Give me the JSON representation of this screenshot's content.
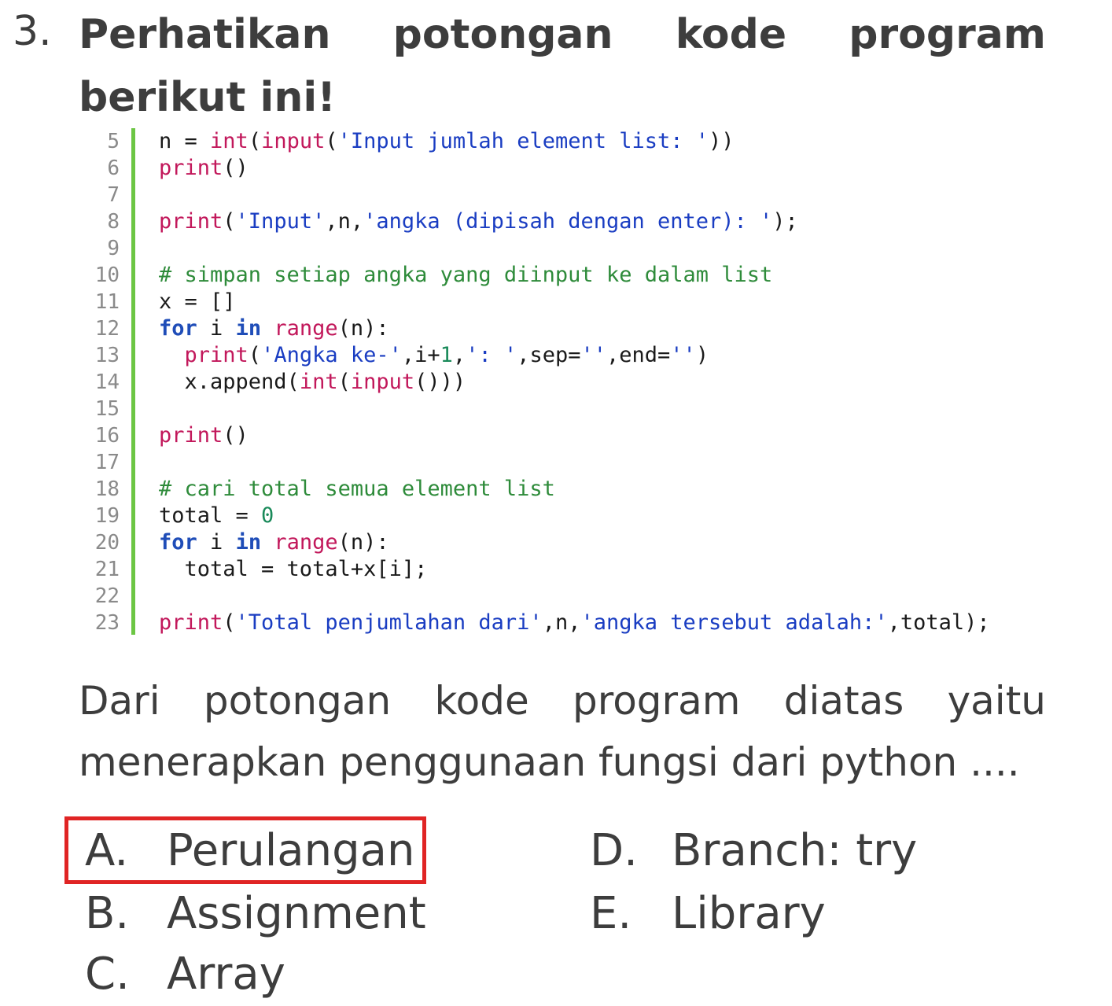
{
  "question": {
    "number": "3.",
    "title": "Perhatikan potongan kode program berikut ini!",
    "text": "Dari potongan kode program diatas yaitu menerapkan penggunaan fungsi dari python ...."
  },
  "code": {
    "lines": [
      {
        "num": "5",
        "text": "n = int(input('Input jumlah element list: '))"
      },
      {
        "num": "6",
        "text": "print()"
      },
      {
        "num": "7",
        "text": ""
      },
      {
        "num": "8",
        "text": "print('Input',n,'angka (dipisah dengan enter): ');"
      },
      {
        "num": "9",
        "text": ""
      },
      {
        "num": "10",
        "text": "# simpan setiap angka yang diinput ke dalam list"
      },
      {
        "num": "11",
        "text": "x = []"
      },
      {
        "num": "12",
        "text": "for i in range(n):"
      },
      {
        "num": "13",
        "text": "  print('Angka ke-',i+1,': ',sep='',end='')"
      },
      {
        "num": "14",
        "text": "  x.append(int(input()))"
      },
      {
        "num": "15",
        "text": ""
      },
      {
        "num": "16",
        "text": "print()"
      },
      {
        "num": "17",
        "text": ""
      },
      {
        "num": "18",
        "text": "# cari total semua element list"
      },
      {
        "num": "19",
        "text": "total = 0"
      },
      {
        "num": "20",
        "text": "for i in range(n):"
      },
      {
        "num": "21",
        "text": "  total = total+x[i];"
      },
      {
        "num": "22",
        "text": ""
      },
      {
        "num": "23",
        "text": "print('Total penjumlahan dari',n,'angka tersebut adalah:',total);"
      }
    ]
  },
  "options": [
    {
      "letter": "A.",
      "label": "Perulangan",
      "marked": true
    },
    {
      "letter": "B.",
      "label": "Assignment",
      "marked": false
    },
    {
      "letter": "C.",
      "label": "Array",
      "marked": false
    },
    {
      "letter": "D.",
      "label": "Branch: try",
      "marked": false
    },
    {
      "letter": "E.",
      "label": "Library",
      "marked": false
    }
  ],
  "colors": {
    "text": "#3d3d3d",
    "code_bar": "#6cc644",
    "keyword": "#1f4db8",
    "builtin": "#c2185b",
    "string": "#1a3dc2",
    "comment": "#2e8b3a",
    "highlight_border": "#e02424"
  }
}
